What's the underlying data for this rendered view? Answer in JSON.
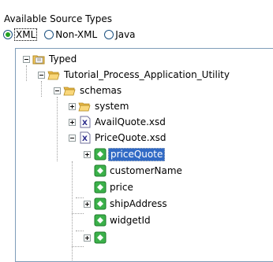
{
  "header": {
    "title": "Available Source Types"
  },
  "source_type": {
    "options": [
      {
        "label": "XML",
        "selected": true
      },
      {
        "label": "Non-XML",
        "selected": false
      },
      {
        "label": "Java",
        "selected": false
      }
    ]
  },
  "tree": {
    "typed": "Typed",
    "project": "Tutorial_Process_Application_Utility",
    "schemas": "schemas",
    "system": "system",
    "availquote": "AvailQuote.xsd",
    "pricequote": "PriceQuote.xsd",
    "elements": {
      "pricequote_el": "priceQuote",
      "customername": "customerName",
      "price": "price",
      "shipaddress": "shipAddress",
      "widgetid": "widgetId"
    }
  },
  "colors": {
    "selection": "#316ac5",
    "radio_dot": "#21a121",
    "folder": "#f4c85a",
    "element_icon": "#3bb14a"
  }
}
